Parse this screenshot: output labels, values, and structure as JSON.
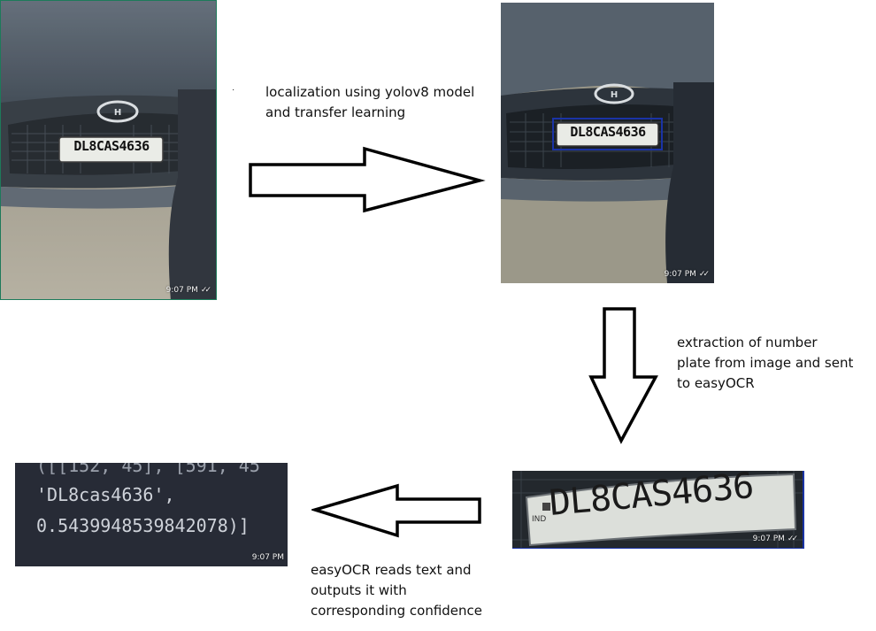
{
  "steps": [
    {
      "caption": "localization using yolov8 model\n and transfer learning"
    },
    {
      "caption": "extraction of number\nplate from image and sent\nto easyOCR"
    },
    {
      "caption": "easyOCR reads text and\noutputs it with\ncorresponding confidence"
    }
  ],
  "photos": {
    "timestamp": "9:07 PM",
    "read_ticks": "✓✓",
    "plate_text": "DL8CAS4636",
    "plate_country": "IND"
  },
  "ocr_output": {
    "line_1": "([[152, 45], [591, 45",
    "line_2": "'DL8cas4636',",
    "line_3": "0.5439948539842078)]"
  },
  "colors": {
    "bbox": "#1a33a6",
    "panel_bg": "#272b36",
    "photo_border": "#1d7a5a"
  }
}
